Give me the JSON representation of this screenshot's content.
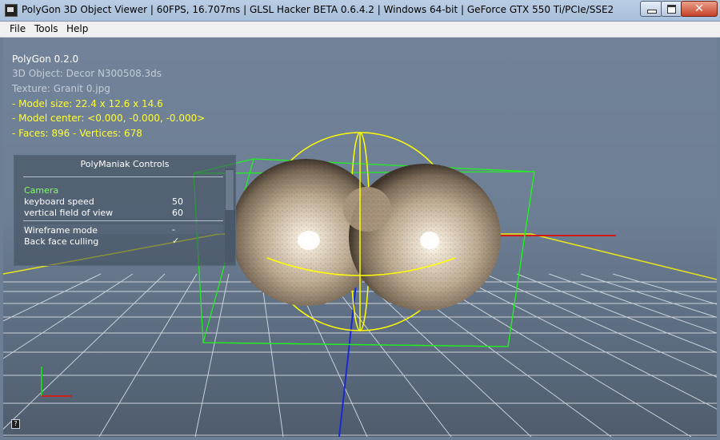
{
  "window": {
    "title": "PolyGon 3D Object Viewer | 60FPS, 16.707ms | GLSL Hacker BETA 0.6.4.2 | Windows 64-bit | GeForce GTX 550 Ti/PCIe/SSE2",
    "close_glyph": "✕"
  },
  "menu": {
    "file": "File",
    "tools": "Tools",
    "help": "Help"
  },
  "info": {
    "app_version": "PolyGon 0.2.0",
    "object": "3D Object: Decor N300508.3ds",
    "texture": "Texture: Granit 0.jpg",
    "model_size": "- Model size:  22.4 x 12.6 x 14.6",
    "model_center": "- Model center:  <0.000, -0.000, -0.000>",
    "faces_vertices": "- Faces: 896 - Vertices: 678"
  },
  "controls": {
    "title": "PolyManiak Controls",
    "section_camera": "Camera",
    "keyboard_speed_label": "keyboard speed",
    "keyboard_speed_value": "50",
    "fov_label": "vertical field of view",
    "fov_value": "60",
    "wireframe_label": "Wireframe mode",
    "wireframe_value": "-",
    "backface_label": "Back face culling",
    "backface_value": "✓"
  },
  "help_icon_glyph": "?",
  "colors": {
    "info_yellow": "#ffff33",
    "camera_green": "#7dff60",
    "bbox_green": "#22ee22",
    "gizmo_yellow": "#ffff00",
    "axis_blue": "#1a2ad0",
    "axis_red": "#d01a1a"
  }
}
